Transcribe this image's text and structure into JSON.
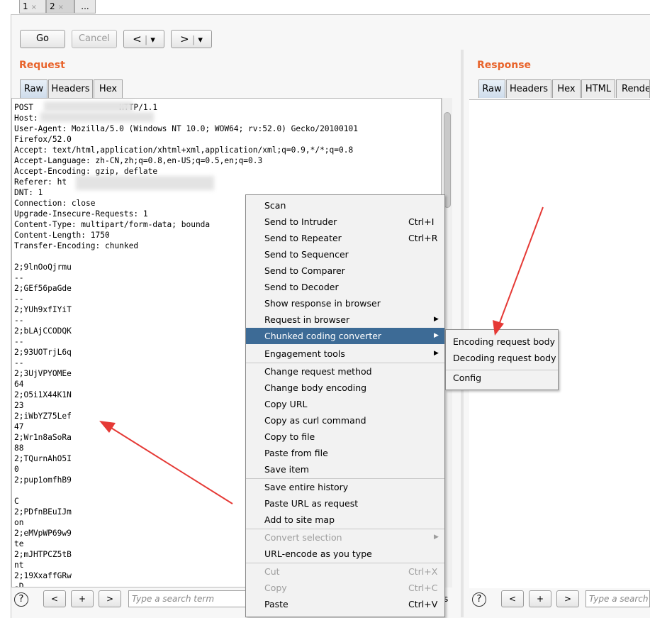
{
  "tabs": [
    {
      "label": "1",
      "close": "×"
    },
    {
      "label": "2",
      "close": "×"
    },
    {
      "label": "..."
    }
  ],
  "toolbar": {
    "go": "Go",
    "cancel": "Cancel",
    "back": "<",
    "forward": ">",
    "dropdown": "▾",
    "sep": "|"
  },
  "request": {
    "title": "Request",
    "tabs": [
      "Raw",
      "Headers",
      "Hex"
    ],
    "lines": [
      "POST                  HTTP/1.1",
      "Host: ",
      "User-Agent: Mozilla/5.0 (Windows NT 10.0; WOW64; rv:52.0) Gecko/20100101",
      "Firefox/52.0",
      "Accept: text/html,application/xhtml+xml,application/xml;q=0.9,*/*;q=0.8",
      "Accept-Language: zh-CN,zh;q=0.8,en-US;q=0.5,en;q=0.3",
      "Accept-Encoding: gzip, deflate",
      "Referer: ht",
      "DNT: 1",
      "Connection: close",
      "Upgrade-Insecure-Requests: 1",
      "Content-Type: multipart/form-data; bounda",
      "Content-Length: 1750",
      "Transfer-Encoding: chunked",
      "",
      "2;9lnOoQjrmu",
      "--",
      "2;GEf56paGde",
      "--",
      "2;YUh9xfIYiT",
      "--",
      "2;bLAjCCODQK",
      "--",
      "2;93UOTrjL6q",
      "--",
      "2;3UjVPYOMEe",
      "64",
      "2;O5i1X44K1N",
      "23",
      "2;iWbYZ75Lef",
      "47",
      "2;Wr1n8aSoRa",
      "88",
      "2;TQurnAhO5I",
      "0",
      "2;pup1omfhB9",
      "",
      "C",
      "2;PDfnBEuIJm",
      "on",
      "2;eMVpWP69w9",
      "te",
      "2;mJHTPCZ5tB",
      "nt",
      "2;19XxaffGRw",
      "-D"
    ],
    "search_placeholder": "Type a search term",
    "match_suffix": "s"
  },
  "response": {
    "title": "Response",
    "tabs": [
      "Raw",
      "Headers",
      "Hex",
      "HTML",
      "Render"
    ],
    "search_placeholder": "Type a search term"
  },
  "bottom": {
    "help": "?",
    "prev": "<",
    "add": "+",
    "next": ">"
  },
  "context_menu": {
    "items": [
      {
        "label": "Scan"
      },
      {
        "label": "Send to Intruder",
        "shortcut": "Ctrl+I"
      },
      {
        "label": "Send to Repeater",
        "shortcut": "Ctrl+R"
      },
      {
        "label": "Send to Sequencer"
      },
      {
        "label": "Send to Comparer"
      },
      {
        "label": "Send to Decoder"
      },
      {
        "label": "Show response in browser"
      },
      {
        "label": "Request in browser",
        "arrow": "▶"
      },
      {
        "label": "Chunked coding converter",
        "arrow": "▶"
      },
      {
        "label": "Engagement tools",
        "arrow": "▶"
      },
      {
        "label": "Change request method"
      },
      {
        "label": "Change body encoding"
      },
      {
        "label": "Copy URL"
      },
      {
        "label": "Copy as curl command"
      },
      {
        "label": "Copy to file"
      },
      {
        "label": "Paste from file"
      },
      {
        "label": "Save item"
      },
      {
        "label": "Save entire history"
      },
      {
        "label": "Paste URL as request"
      },
      {
        "label": "Add to site map"
      },
      {
        "label": "Convert selection",
        "arrow": "▶"
      },
      {
        "label": "URL-encode as you type"
      },
      {
        "label": "Cut",
        "shortcut": "Ctrl+X"
      },
      {
        "label": "Copy",
        "shortcut": "Ctrl+C"
      },
      {
        "label": "Paste",
        "shortcut": "Ctrl+V"
      }
    ]
  },
  "submenu": {
    "items": [
      "Encoding request body",
      "Decoding request body",
      "Config"
    ]
  },
  "colors": {
    "accent": "#e8642c",
    "highlight": "#3d6b96",
    "arrow": "#e53935"
  }
}
